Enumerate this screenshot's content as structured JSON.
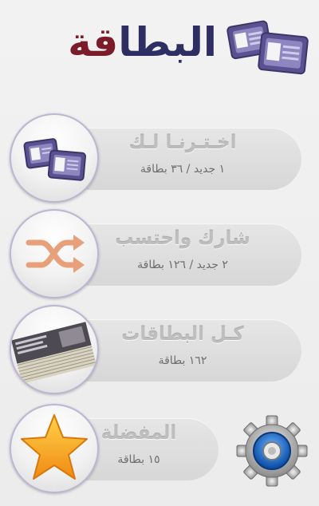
{
  "logo": {
    "text_main": "البطا",
    "text_accent": "قة"
  },
  "menu": [
    {
      "title": "اخـتـرنـا لـك",
      "subtitle": "١ جديد / ٣٦ بطاقة",
      "icon": "cards-icon"
    },
    {
      "title": "شارك واحتسب",
      "subtitle": "٢ جديد / ١٢٦ بطاقة",
      "icon": "shuffle-icon"
    },
    {
      "title": "كـل البطاقات",
      "subtitle": "١٦٢ بطاقة",
      "icon": "card-stack-icon"
    },
    {
      "title": "المفضلة",
      "subtitle": "١٥ بطاقة",
      "icon": "star-icon"
    }
  ],
  "settings": {
    "icon": "gear-icon"
  },
  "colors": {
    "logo_blue": "#2f2e63",
    "logo_maroon": "#7c1c2a",
    "card_purple": "#5a5290",
    "shuffle_orange": "#e8a07a",
    "star_gold": "#f5a623",
    "gear_blue": "#1f6fd1"
  }
}
